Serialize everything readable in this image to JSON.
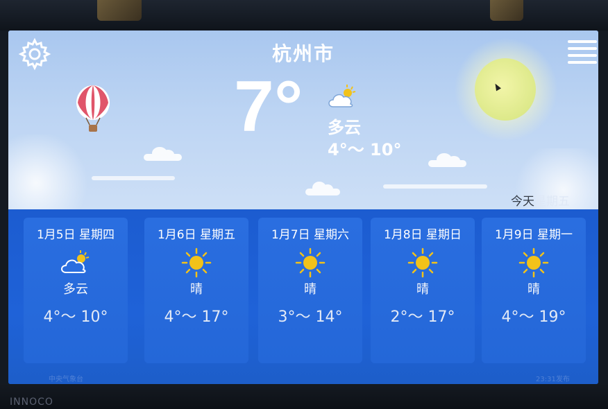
{
  "header": {
    "city": "杭州市",
    "settings_icon": "gear-icon",
    "menu_icon": "hamburger-menu-icon"
  },
  "current": {
    "temperature": "7°",
    "condition": "多云",
    "range": "4°～ 10°",
    "icon": "partly-cloudy-icon"
  },
  "day_switch": {
    "today_label": "今天",
    "weekday_label": "星期五"
  },
  "forecast": [
    {
      "date": "1月5日 星期四",
      "icon": "partly-cloudy-icon",
      "condition": "多云",
      "range": "4°～ 10°"
    },
    {
      "date": "1月6日 星期五",
      "icon": "sunny-icon",
      "condition": "晴",
      "range": "4°～ 17°"
    },
    {
      "date": "1月7日 星期六",
      "icon": "sunny-icon",
      "condition": "晴",
      "range": "3°～ 14°"
    },
    {
      "date": "1月8日 星期日",
      "icon": "sunny-icon",
      "condition": "晴",
      "range": "2°～ 17°"
    },
    {
      "date": "1月9日 星期一",
      "icon": "sunny-icon",
      "condition": "晴",
      "range": "4°～ 19°"
    }
  ],
  "footer": {
    "source": "中央气象台",
    "published": "23:31发布"
  },
  "device": {
    "brand": "INNOCO"
  },
  "colors": {
    "sky_top": "#a9c7ef",
    "forecast_bg": "#1c5cd0",
    "card_bg": "#2a6ee0",
    "sun_yellow": "#f2c21a"
  }
}
